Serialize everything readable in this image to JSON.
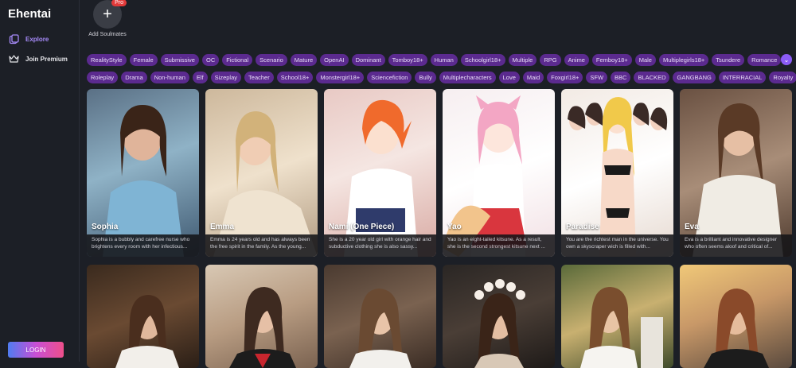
{
  "app": {
    "title": "Ehentai"
  },
  "sidebar": {
    "items": [
      {
        "label": "Explore",
        "icon": "explore-icon"
      },
      {
        "label": "Join Premium",
        "icon": "crown-icon"
      }
    ],
    "login_label": "LOGIN"
  },
  "add_soulmates": {
    "label": "Add Soulmates",
    "badge": "Pro"
  },
  "tags_row1": [
    "RealityStyle",
    "Female",
    "Submissive",
    "OC",
    "Fictional",
    "Scenario",
    "Mature",
    "OpenAI",
    "Dominant",
    "Tomboy18+",
    "Human",
    "Schoolgirl18+",
    "Multiple",
    "RPG",
    "Anime",
    "Femboy18+",
    "Male",
    "Multiplegirls18+",
    "Tsundere",
    "Romance"
  ],
  "tags_row2": [
    "Roleplay",
    "Drama",
    "Non-human",
    "Elf",
    "Sizeplay",
    "Teacher",
    "School18+",
    "Monstergirl18+",
    "Sciencefiction",
    "Bully",
    "Multiplecharacters",
    "Love",
    "Maid",
    "Foxgirl18+",
    "SFW",
    "BBC",
    "BLACKED",
    "GANGBANG",
    "INTERRACIAL",
    "Royalty"
  ],
  "cards": [
    {
      "name": "Sophia",
      "desc": "Sophia is a bubbly and carefree nurse who brightens every room with her infectious..."
    },
    {
      "name": "Emma",
      "desc": "Emma is 24 years old and has always been the free spirit in the family. As the young..."
    },
    {
      "name": "Nami (One Piece)",
      "desc": "She is a 20 year old girl with orange hair and subductive clothing she is also sassy..."
    },
    {
      "name": "Yao",
      "desc": "Yao is an eight-tailed kitsune. As a result, she is the second strongest kitsune next ..."
    },
    {
      "name": "Paradise",
      "desc": "You are the richtest man in the universe. You own a skyscraper wich is filled with..."
    },
    {
      "name": "Eva",
      "desc": "Eva is a brilliant and innovative designer who often seems aloof and critical of..."
    }
  ],
  "colors": {
    "accent": "#8b5cf6",
    "tag_bg": "#5b2a8f",
    "background": "#1c1f26"
  }
}
